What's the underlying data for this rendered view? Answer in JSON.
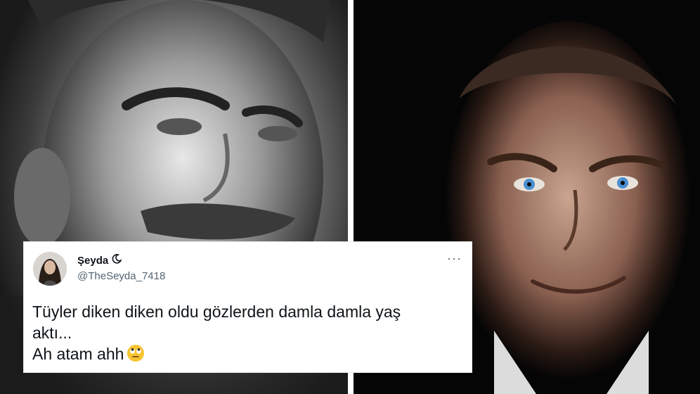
{
  "tweet": {
    "display_name": "Şeyda",
    "handle": "@TheSeyda_7418",
    "more_label": "···",
    "text_line1": "Tüyler diken diken oldu gözlerden damla damla yaş",
    "text_line2": "aktı...",
    "text_line3": "Ah atam ahh",
    "emoji": "face-with-rolling-eyes-icon"
  },
  "images": {
    "left": "man-portrait-black-and-white",
    "right": "man-portrait-blue-eyes"
  },
  "colors": {
    "text_primary": "#0f1419",
    "text_secondary": "#536471",
    "card_bg": "#ffffff"
  }
}
